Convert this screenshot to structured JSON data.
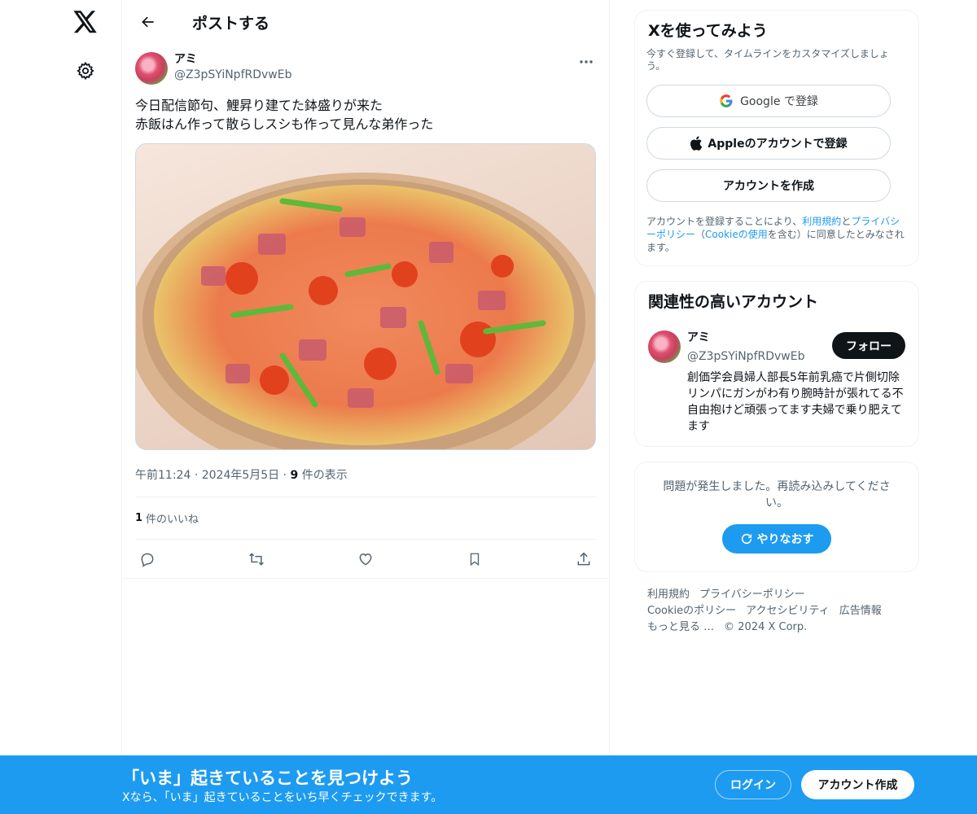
{
  "header": {
    "title": "ポストする"
  },
  "post": {
    "author_name": "アミ",
    "author_handle": "@Z3pSYiNpfRDvwEb",
    "text": "今日配信節句、鯉昇り建てた鉢盛りが来た\n赤飯はん作って散らしスシも作って見んな弟作った",
    "time": "午前11:24",
    "date": "2024年5月5日",
    "views_count": "9",
    "views_label": "件の表示",
    "likes_count": "1",
    "likes_label": "件のいいね",
    "separator": "·"
  },
  "signup_card": {
    "title": "Xを使ってみよう",
    "subtitle": "今すぐ登録して、タイムラインをカスタマイズしましょう。",
    "google_label": "Google で登録",
    "apple_label": "Appleのアカウントで登録",
    "create_label": "アカウントを作成",
    "legal_1": "アカウントを登録することにより、",
    "legal_terms": "利用規約",
    "legal_2": "と",
    "legal_privacy": "プライバシーポリシー",
    "legal_3": "（",
    "legal_cookie": "Cookieの使用",
    "legal_4": "を含む）に同意したとみなされます。"
  },
  "related_card": {
    "title": "関連性の高いアカウント",
    "name": "アミ",
    "handle": "@Z3pSYiNpfRDvwEb",
    "follow_label": "フォロー",
    "bio": "創価学会員婦人部長5年前乳癌で片側切除リンパにガンがわ有り腕時計が張れてる不自由抱けど頑張ってます夫婦で乗り肥えてます"
  },
  "error_card": {
    "message": "問題が発生しました。再読み込みしてください。",
    "retry_label": "やりなおす"
  },
  "footer": {
    "terms": "利用規約",
    "privacy": "プライバシーポリシー",
    "cookie": "Cookieのポリシー",
    "accessibility": "アクセシビリティ",
    "ads": "広告情報",
    "more": "もっと見る …",
    "copyright": "© 2024 X Corp."
  },
  "banner": {
    "title": "「いま」起きていることを見つけよう",
    "subtitle": "Xなら、「いま」起きていることをいち早くチェックできます。",
    "login_label": "ログイン",
    "signup_label": "アカウント作成"
  },
  "colors": {
    "accent": "#1d9bf0",
    "text": "#0f1419",
    "muted": "#536471"
  },
  "icons": [
    "x-logo-icon",
    "gear-icon",
    "back-arrow-icon",
    "more-icon",
    "reply-icon",
    "repost-icon",
    "like-icon",
    "bookmark-icon",
    "share-icon",
    "google-icon",
    "apple-icon",
    "refresh-icon"
  ]
}
